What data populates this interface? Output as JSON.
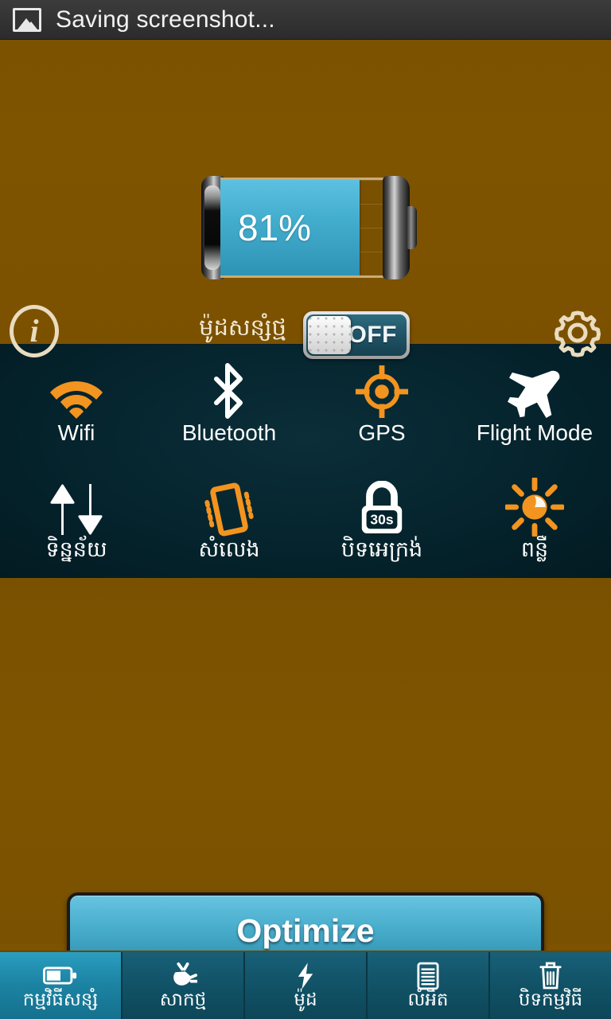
{
  "statusbar": {
    "icon": "screenshot-image-icon",
    "text": "Saving screenshot..."
  },
  "battery": {
    "percent_label": "81%",
    "percent_value": 81,
    "fill_color": "#44aecf",
    "empty_color": "#7a5100"
  },
  "power_saver": {
    "info_icon": "info-icon",
    "info_glyph": "i",
    "label": "ម៉ូដសន្សំថ្ម",
    "toggle_state_label": "OFF",
    "toggle_on": false,
    "settings_icon": "gear-icon"
  },
  "quick_toggles": [
    {
      "icon": "wifi-icon",
      "label": "Wifi",
      "active": true,
      "color": "#f2941f"
    },
    {
      "icon": "bluetooth-icon",
      "label": "Bluetooth",
      "active": false,
      "color": "#ffffff"
    },
    {
      "icon": "gps-icon",
      "label": "GPS",
      "active": true,
      "color": "#f2941f"
    },
    {
      "icon": "airplane-icon",
      "label": "Flight Mode",
      "active": false,
      "color": "#ffffff"
    },
    {
      "icon": "data-arrows-icon",
      "label": "ទិន្នន័យ",
      "active": false,
      "color": "#ffffff"
    },
    {
      "icon": "vibrate-icon",
      "label": "សំលេង",
      "active": true,
      "color": "#f2941f"
    },
    {
      "icon": "screen-lock-timeout-icon",
      "label": "បិទអេក្រង់",
      "active": false,
      "color": "#ffffff",
      "badge": "30s"
    },
    {
      "icon": "brightness-sun-icon",
      "label": "ពន្លឺ",
      "active": true,
      "color": "#f2941f"
    }
  ],
  "optimize": {
    "label": "Optimize",
    "color": "#49aecd"
  },
  "tabs": [
    {
      "icon": "battery-horizontal-icon",
      "label": "កម្មវិធីសន្សំ",
      "active": true
    },
    {
      "icon": "power-plug-icon",
      "label": "សាកថ្ម",
      "active": false
    },
    {
      "icon": "lightning-bolt-icon",
      "label": "ម៉ូដ",
      "active": false
    },
    {
      "icon": "document-lines-icon",
      "label": "លំអិត",
      "active": false
    },
    {
      "icon": "trash-can-icon",
      "label": "បិទកម្មវិធី",
      "active": false
    }
  ],
  "theme": {
    "background_brown": "#7d5200",
    "panel_dark": "#04232c",
    "accent_orange": "#f2941f",
    "accent_blue": "#44aecf",
    "tab_teal": "#115266",
    "tab_active_teal": "#1d84a4"
  }
}
